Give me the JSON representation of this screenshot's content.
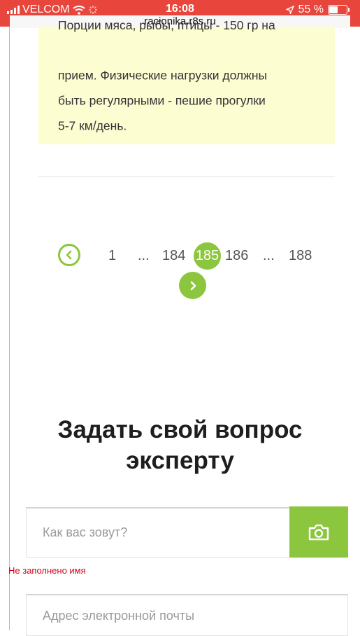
{
  "status_bar": {
    "carrier": "VELCOM",
    "time": "16:08",
    "battery": "55 %",
    "battery_level_percent": 55,
    "url": "racionika.r8s.ru"
  },
  "note": {
    "lines": [
      "Порции мяса, рыбы, птицы - 150 гр на",
      "прием. Физические нагрузки должны",
      "быть регулярными - пешие прогулки",
      "5-7 км/день."
    ],
    "background": "#fdfdd2"
  },
  "pagination": {
    "first": "1",
    "ellipsis_left": "...",
    "prev_page": "184",
    "current_page": "185",
    "next_page": "186",
    "ellipsis_right": "...",
    "last": "188"
  },
  "form": {
    "heading_line1": "Задать свой вопрос",
    "heading_line2": "эксперту",
    "name_placeholder": "Как вас зовут?",
    "name_error": "Не заполнено имя",
    "email_placeholder": "Адрес электронной почты"
  },
  "colors": {
    "accent": "#8cc63f",
    "status_bar": "#e8453c",
    "error": "#d0021b"
  },
  "icons": [
    "wifi-icon",
    "location-arrow-icon",
    "battery-icon",
    "chevron-left-icon",
    "chevron-right-icon",
    "camera-icon"
  ]
}
